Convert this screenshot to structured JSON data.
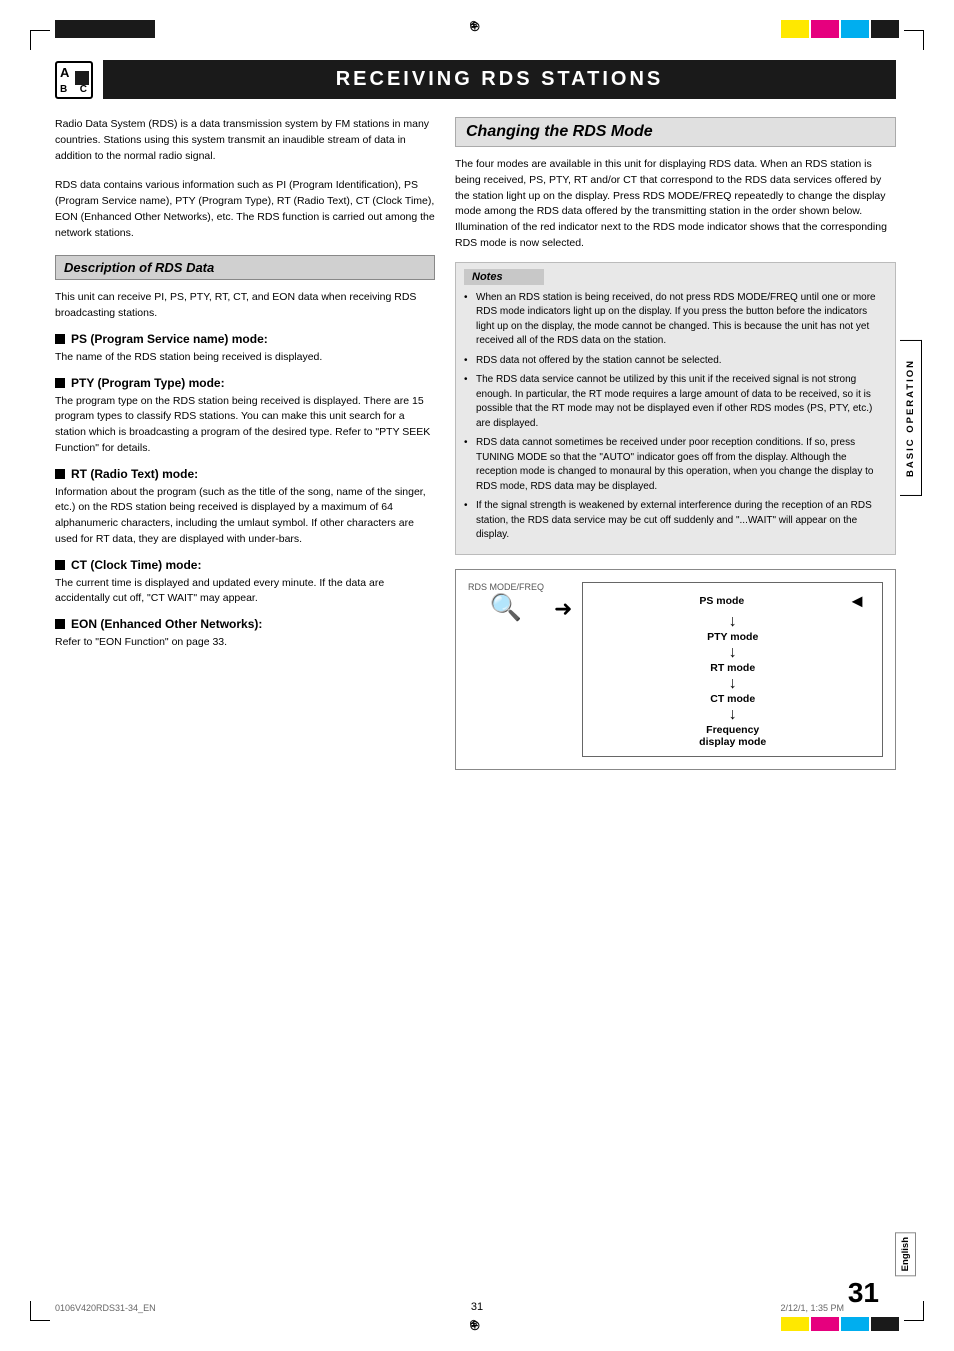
{
  "page": {
    "number": "31",
    "footer_left": "0106V420RDS31-34_EN",
    "footer_center": "31",
    "footer_right": "2/12/1, 1:35 PM"
  },
  "title": "RECEIVING RDS STATIONS",
  "abc_letters": {
    "a": "A",
    "b": "B",
    "c": "C"
  },
  "intro_paragraphs": [
    "Radio Data System (RDS) is a data transmission system by FM stations in many countries. Stations using this system transmit an inaudible stream of data in addition to the normal radio signal.",
    "RDS data contains various information such as PI (Program Identification), PS (Program Service name), PTY (Program Type), RT (Radio Text), CT (Clock Time), EON (Enhanced Other Networks), etc. The RDS function is carried out among the network stations."
  ],
  "description_section": {
    "header": "Description of RDS Data",
    "intro": "This unit can receive PI, PS, PTY, RT, CT, and EON data when receiving RDS broadcasting stations.",
    "items": [
      {
        "title": "PS (Program Service name) mode:",
        "text": "The name of the RDS station being received is displayed."
      },
      {
        "title": "PTY (Program Type) mode:",
        "text": "The program type on the RDS station being received is displayed. There are 15 program types to classify RDS stations. You can make this unit search for a station which is broadcasting a program of the desired type. Refer to \"PTY SEEK Function\" for details."
      },
      {
        "title": "RT (Radio Text) mode:",
        "text": "Information about the program (such as the title of the song, name of the singer, etc.) on the RDS station being received is displayed by a maximum of 64 alphanumeric characters, including the umlaut symbol. If other characters are used for RT data, they are displayed with under-bars."
      },
      {
        "title": "CT (Clock Time) mode:",
        "text": "The current time is displayed and updated every minute. If the data are accidentally cut off, \"CT WAIT\" may appear."
      },
      {
        "title": "EON (Enhanced Other Networks):",
        "text": "Refer to \"EON Function\" on page 33."
      }
    ]
  },
  "changing_rds_section": {
    "header": "Changing the RDS Mode",
    "text": "The four modes are available in this unit for displaying RDS data. When an RDS station is being received, PS, PTY, RT and/or CT that correspond to the RDS data services offered by the station light up on the display. Press RDS MODE/FREQ repeatedly to change the display mode among the RDS data offered by the transmitting station in the order shown below. Illumination of the red indicator next to the RDS mode indicator shows that the corresponding RDS mode is now selected.",
    "notes_header": "Notes",
    "notes": [
      "When an RDS station is being received, do not press RDS MODE/FREQ until one or more RDS mode indicators light up on the display. If you press the button before the indicators light up on the display, the mode cannot be changed. This is because the unit has not yet received all of the RDS data on the station.",
      "RDS data not offered by the station cannot be selected.",
      "The RDS data service cannot be utilized by this unit if the received signal is not strong enough. In particular, the RT mode requires a large amount of data to be received, so it is possible that the RT mode may not be displayed even if other RDS modes (PS, PTY, etc.) are displayed.",
      "RDS data cannot sometimes be received under poor reception conditions. If so, press TUNING MODE so that the \"AUTO\" indicator goes off from the display. Although the reception mode is changed to monaural by this operation, when you change the display to RDS mode, RDS data may be displayed.",
      "If the signal strength is weakened by external interference during the reception of an RDS station, the RDS data service may be cut off suddenly and \"...WAIT\" will appear on the display."
    ],
    "diagram": {
      "rds_label": "RDS MODE/FREQ",
      "modes": [
        "PS mode",
        "PTY mode",
        "RT mode",
        "CT mode",
        "Frequency\ndisplay mode"
      ]
    }
  },
  "sidebar_label": "BASIC OPERATION",
  "english_label": "English"
}
